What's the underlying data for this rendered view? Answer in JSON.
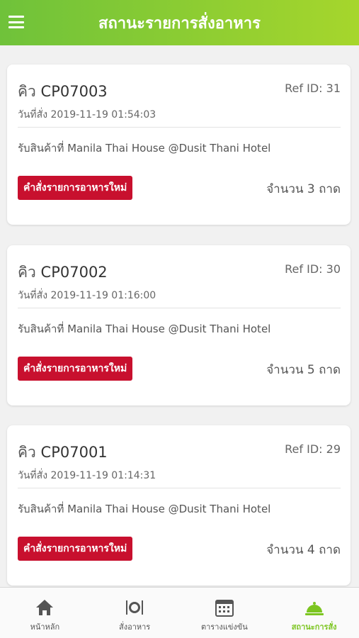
{
  "header": {
    "title": "สถานะรายการสั่งอาหาร"
  },
  "orders": [
    {
      "queue_prefix": "คิว",
      "queue_no": "CP07003",
      "ref": "Ref ID: 31",
      "date": "วันที่สั่ง 2019-11-19 01:54:03",
      "pickup": "รับสินค้าที่ Manila Thai House @Dusit Thani Hotel",
      "status": "คำสั่งรายการอาหารใหม่",
      "quantity": "จำนวน 3 ถาด"
    },
    {
      "queue_prefix": "คิว",
      "queue_no": "CP07002",
      "ref": "Ref ID: 30",
      "date": "วันที่สั่ง 2019-11-19 01:16:00",
      "pickup": "รับสินค้าที่ Manila Thai House @Dusit Thani Hotel",
      "status": "คำสั่งรายการอาหารใหม่",
      "quantity": "จำนวน 5 ถาด"
    },
    {
      "queue_prefix": "คิว",
      "queue_no": "CP07001",
      "ref": "Ref ID: 29",
      "date": "วันที่สั่ง 2019-11-19 01:14:31",
      "pickup": "รับสินค้าที่ Manila Thai House @Dusit Thani Hotel",
      "status": "คำสั่งรายการอาหารใหม่",
      "quantity": "จำนวน 4 ถาด"
    }
  ],
  "tabs": [
    {
      "label": "หน้าหลัก",
      "icon": "home-icon"
    },
    {
      "label": "สั่งอาหาร",
      "icon": "dining-icon"
    },
    {
      "label": "ตารางแข่งขัน",
      "icon": "calendar-icon"
    },
    {
      "label": "สถานะการสั่ง",
      "icon": "food-cloche-icon",
      "active": true
    }
  ],
  "colors": {
    "header_start": "#6fc23a",
    "header_end": "#a6d62c",
    "status_badge": "#c8102e",
    "active_tab": "#7cc520"
  }
}
